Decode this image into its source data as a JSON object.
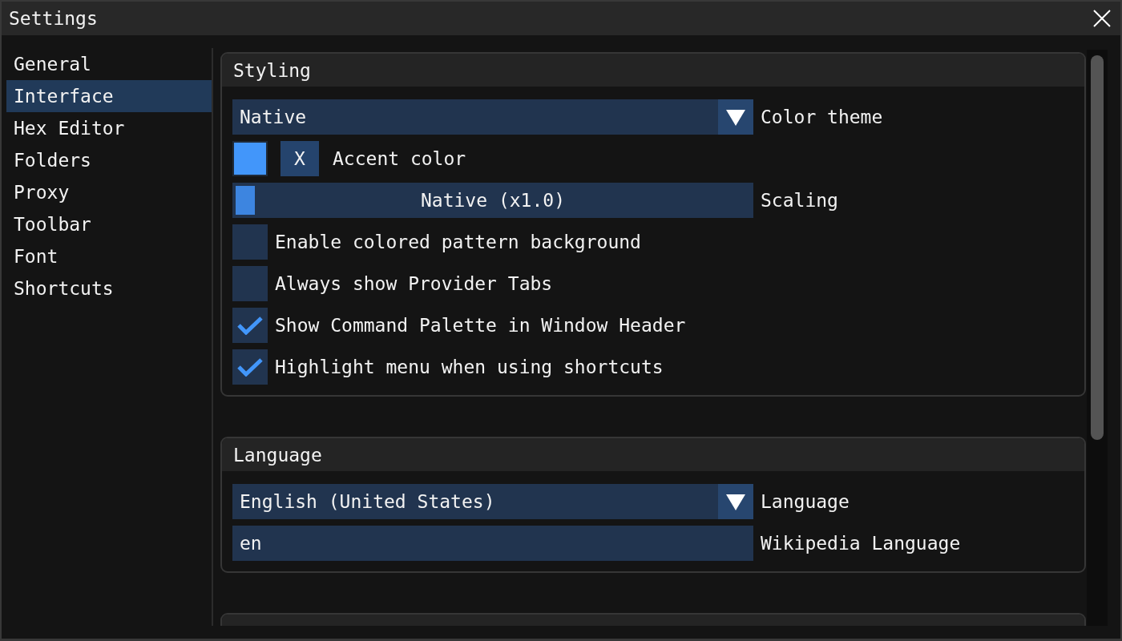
{
  "window": {
    "title": "Settings"
  },
  "sidebar": {
    "items": [
      {
        "label": "General",
        "selected": false
      },
      {
        "label": "Interface",
        "selected": true
      },
      {
        "label": "Hex Editor",
        "selected": false
      },
      {
        "label": "Folders",
        "selected": false
      },
      {
        "label": "Proxy",
        "selected": false
      },
      {
        "label": "Toolbar",
        "selected": false
      },
      {
        "label": "Font",
        "selected": false
      },
      {
        "label": "Shortcuts",
        "selected": false
      }
    ]
  },
  "sections": [
    {
      "title": "Styling",
      "rows": [
        {
          "kind": "dropdown",
          "value": "Native",
          "label": "Color theme"
        },
        {
          "kind": "color",
          "color": "#4296fa",
          "button": "X",
          "label": "Accent color"
        },
        {
          "kind": "slider",
          "text": "Native (x1.0)",
          "level": 0,
          "label": "Scaling"
        },
        {
          "kind": "checkbox",
          "label": "Enable colored pattern background",
          "checked": false
        },
        {
          "kind": "checkbox",
          "label": "Always show Provider Tabs",
          "checked": false
        },
        {
          "kind": "checkbox",
          "label": "Show Command Palette in Window Header",
          "checked": true
        },
        {
          "kind": "checkbox",
          "label": "Highlight menu when using shortcuts",
          "checked": true
        }
      ]
    },
    {
      "title": "Language",
      "rows": [
        {
          "kind": "dropdown",
          "value": "English (United States)",
          "label": "Language"
        },
        {
          "kind": "input",
          "value": "en",
          "label": "Wikipedia Language"
        }
      ]
    }
  ],
  "sections_continue_below": true
}
